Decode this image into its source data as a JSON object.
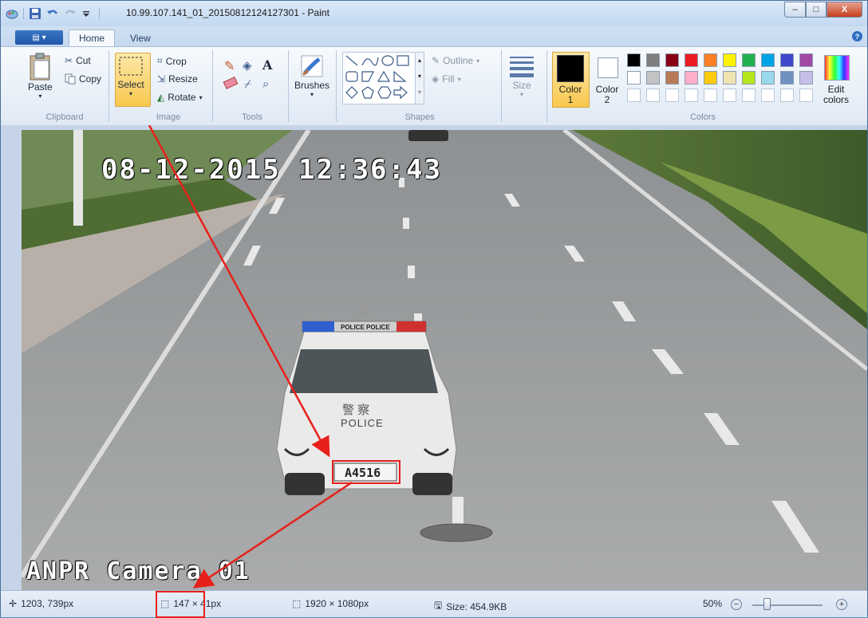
{
  "window": {
    "title": "10.99.107.141_01_20150812124127301 - Paint",
    "min_label": "–",
    "max_label": "□",
    "close_label": "X"
  },
  "tabs": {
    "app_menu": "▤ ▾",
    "home": "Home",
    "view": "View",
    "help": "?"
  },
  "clipboard": {
    "paste": "Paste",
    "cut": "Cut",
    "copy": "Copy",
    "label": "Clipboard"
  },
  "image_group": {
    "select": "Select",
    "crop": "Crop",
    "resize": "Resize",
    "rotate": "Rotate",
    "label": "Image"
  },
  "tools": {
    "label": "Tools",
    "text_tool": "A"
  },
  "brushes": {
    "label": "Brushes"
  },
  "shapes": {
    "outline": "Outline",
    "fill": "Fill",
    "label": "Shapes"
  },
  "size": {
    "label": "Size"
  },
  "colors": {
    "color1": "Color 1",
    "color2": "Color 2",
    "edit": "Edit colors",
    "label": "Colors",
    "palette_row1": [
      "#000000",
      "#7f7f7f",
      "#880015",
      "#ed1c24",
      "#ff7f27",
      "#fff200",
      "#22b14c",
      "#00a2e8",
      "#3f48cc",
      "#a349a4"
    ],
    "palette_row2": [
      "#ffffff",
      "#c3c3c3",
      "#b97a57",
      "#ffaec9",
      "#ffc90e",
      "#efe4b0",
      "#b5e61d",
      "#99d9ea",
      "#7092be",
      "#c8bfe7"
    ]
  },
  "image": {
    "timestamp": "08-12-2015 12:36:43",
    "camera_label": "ANPR Camera 01",
    "police_text": "POLICE",
    "police_cn": "警 察",
    "lightbar_text": "POLICE POLICE",
    "plate": "A4516"
  },
  "status": {
    "cursor_pos": "1203, 739px",
    "selection_size": "147 × 41px",
    "image_size": "1920 × 1080px",
    "file_size": "Size: 454.9KB",
    "zoom": "50%",
    "zoom_out": "−",
    "zoom_in": "+"
  }
}
